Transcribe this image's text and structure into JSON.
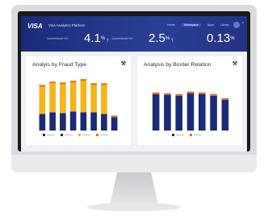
{
  "app": {
    "logo": "VISA",
    "title": "Visa Analytics Platform",
    "nav": [
      "Home",
      "Workspace",
      "Apps",
      "Library"
    ],
    "active_nav": "Workspace"
  },
  "stats": [
    {
      "label": "Current Month YoY",
      "value": "4.1",
      "unit": "%",
      "arrow": "↑"
    },
    {
      "label": "Current Month YoY",
      "value": "2.5",
      "unit": "%",
      "arrow": "↑"
    },
    {
      "label": "",
      "value": "0.13",
      "unit": "%",
      "arrow": ""
    }
  ],
  "cards": {
    "fraud": {
      "title": "Analyis by Fraud Type"
    },
    "border": {
      "title": "Analysis by Border Relation"
    }
  },
  "chart_data": [
    {
      "type": "bar",
      "title": "Analyis by Fraud Type",
      "categories": [
        "",
        "",
        "",
        "",
        "",
        "",
        "",
        ""
      ],
      "series": [
        {
          "color": "#1a2b78",
          "values": [
            20,
            22,
            21,
            23,
            22,
            22,
            20,
            16
          ]
        },
        {
          "color": "#f5b41a",
          "values": [
            33,
            35,
            35,
            35,
            38,
            33,
            35,
            0
          ]
        },
        {
          "color": "#e86a1c",
          "values": [
            2,
            2,
            2,
            2,
            2,
            2,
            2,
            2
          ]
        }
      ],
      "legend_labels": [
        "",
        "",
        "",
        ""
      ],
      "legend_colors": [
        "#1a2b78",
        "#1a2b78",
        "#f5b41a",
        "#e86a1c"
      ],
      "ylim": [
        0,
        70
      ]
    },
    {
      "type": "bar",
      "title": "Analysis by Border Relation",
      "categories": [
        "",
        "",
        "",
        "",
        "",
        "",
        ""
      ],
      "series": [
        {
          "color": "#1a2b78",
          "values": [
            44,
            43,
            42,
            45,
            44,
            42,
            37
          ]
        },
        {
          "color": "#e86a1c",
          "values": [
            2,
            2,
            2,
            2,
            2,
            2,
            2
          ]
        }
      ],
      "legend_labels": [
        "",
        ""
      ],
      "legend_colors": [
        "#1a2b78",
        "#e86a1c"
      ],
      "ylim": [
        0,
        70
      ]
    }
  ]
}
